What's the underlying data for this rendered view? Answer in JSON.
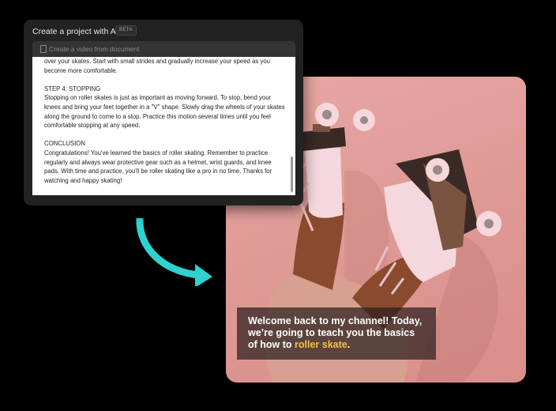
{
  "panel": {
    "title": "Create a project with AI",
    "badge": "BETA",
    "doc_button_label": "Create a video from document",
    "doc_icon": "document-icon",
    "paragraphs": [
      "over your skates. Start with small strides and gradually increase your speed as you become more comfortable.",
      "STEP 4: STOPPING\nStopping on roller skates is just as important as moving forward. To stop, bend your knees and bring your feet together in a \"V\" shape. Slowly drag the wheels of your skates along the ground to come to a stop. Practice this motion several times until you feel comfortable stopping at any speed.",
      "CONCLUSION\nCongratulations! You've learned the basics of roller skating. Remember to practice regularly and always wear protective gear such as a helmet, wrist guards, and knee pads. With time and practice, you'll be roller skating like a pro in no time. Thanks for watching and happy skating!"
    ]
  },
  "video": {
    "caption_before": "Welcome back to my channel! Today, we’re going to teach you the basics of how to ",
    "caption_highlight": "roller skate",
    "caption_after": ".",
    "highlight_color": "#f6c23a"
  },
  "colors": {
    "arrow": "#2ed3cf",
    "background": "#000000",
    "panel": "#222222",
    "photo_bg": "#e09b97"
  }
}
